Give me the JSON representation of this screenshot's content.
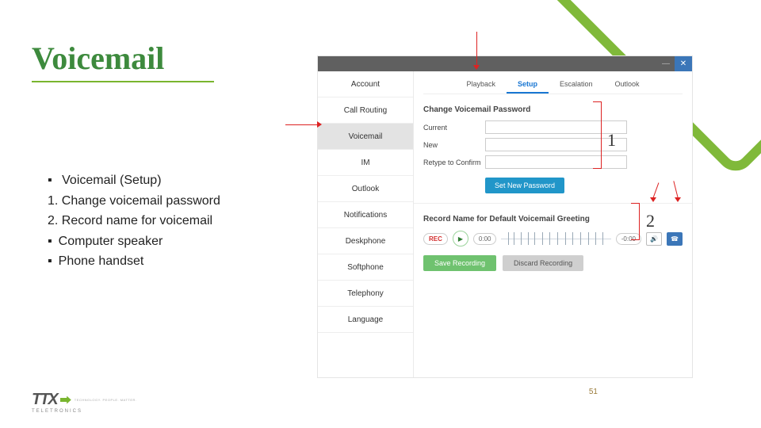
{
  "title": "Voicemail",
  "bullets": {
    "root": "Voicemail (Setup)",
    "items": [
      "Change voicemail password",
      "Record name for voicemail"
    ],
    "sub": [
      "Computer speaker",
      "Phone handset"
    ]
  },
  "annotations": {
    "one": "1",
    "two": "2"
  },
  "app": {
    "sidenav": [
      "Account",
      "Call Routing",
      "Voicemail",
      "IM",
      "Outlook",
      "Notifications",
      "Deskphone",
      "Softphone",
      "Telephony",
      "Language"
    ],
    "active_side": "Voicemail",
    "tabs": [
      "Playback",
      "Setup",
      "Escalation",
      "Outlook"
    ],
    "active_tab": "Setup",
    "pw_section": "Change Voicemail Password",
    "pw_labels": {
      "current": "Current",
      "new": "New",
      "retype": "Retype to Confirm"
    },
    "btn_setpw": "Set New Password",
    "rec_section": "Record Name for Default Voicemail Greeting",
    "rec_label": "REC",
    "rec_time": "0:00",
    "rec_duration": "-0:00",
    "btn_save": "Save Recording",
    "btn_discard": "Discard Recording"
  },
  "page_number": "51",
  "logo": {
    "mark": "TTX",
    "sub": "TELETRONICS",
    "tag": "TECHNOLOGY. PEOPLE. MATTER."
  }
}
